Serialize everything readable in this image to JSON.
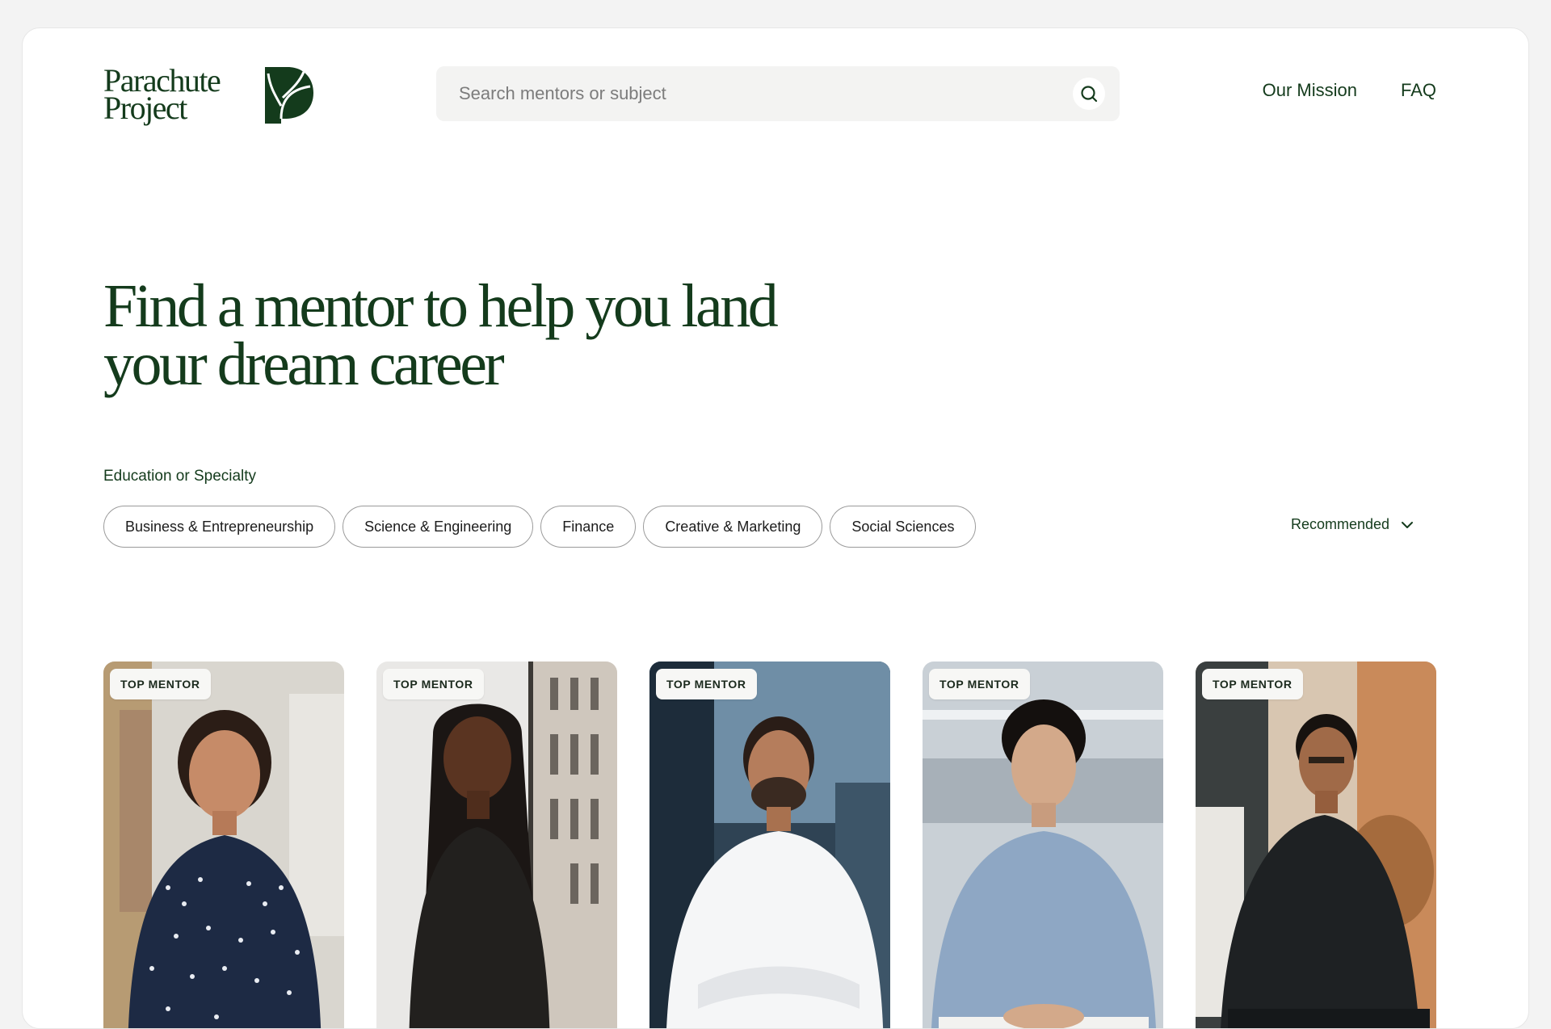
{
  "brand": {
    "name": "Parachute\nProject",
    "color": "#143b1c"
  },
  "search": {
    "placeholder": "Search mentors or subject",
    "value": ""
  },
  "nav": {
    "mission": "Our Mission",
    "faq": "FAQ"
  },
  "hero": {
    "title": "Find a mentor to help you land your dream career"
  },
  "filters": {
    "label": "Education or Specialty",
    "chips": [
      "Business & Entrepreneurship",
      "Science & Engineering",
      "Finance",
      "Creative & Marketing",
      "Social Sciences"
    ],
    "sort": "Recommended"
  },
  "mentors": [
    {
      "badge": "TOP MENTOR",
      "photo": "mentor-photo-woman-polka-dot-shirt"
    },
    {
      "badge": "TOP MENTOR",
      "photo": "mentor-photo-woman-braids-black-top"
    },
    {
      "badge": "TOP MENTOR",
      "photo": "mentor-photo-man-white-shirt"
    },
    {
      "badge": "TOP MENTOR",
      "photo": "mentor-photo-man-denim-shirt"
    },
    {
      "badge": "TOP MENTOR",
      "photo": "mentor-photo-man-glasses-black-sweater"
    }
  ]
}
